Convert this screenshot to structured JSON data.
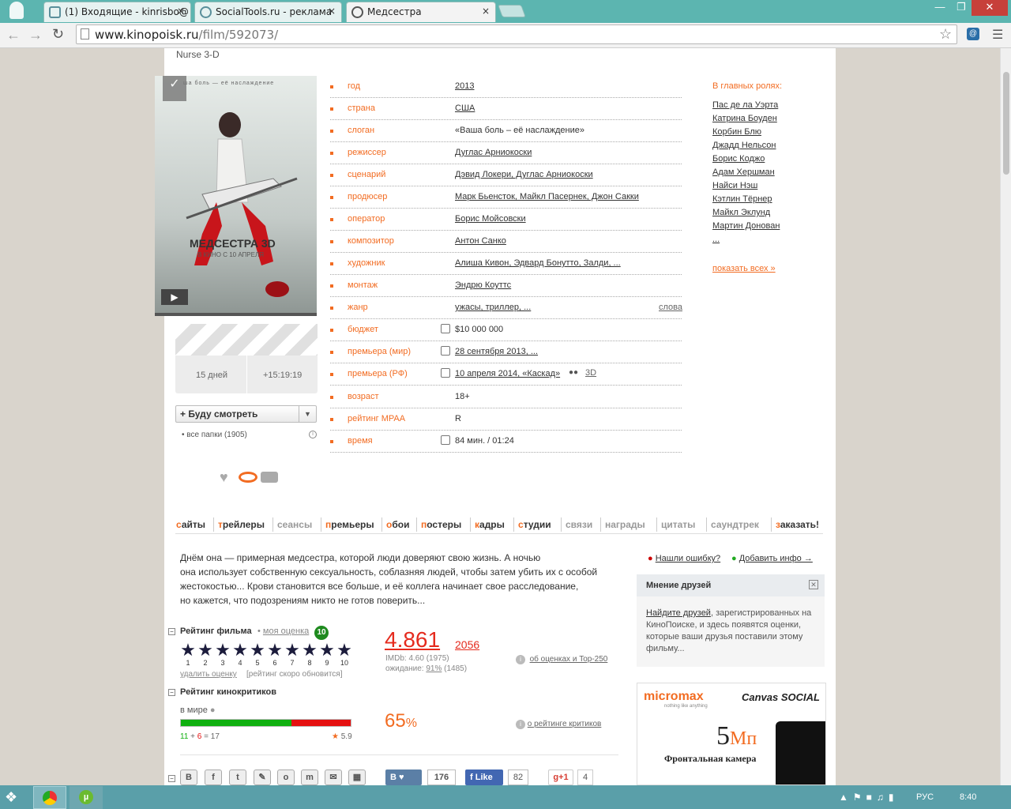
{
  "browser": {
    "tabs": [
      {
        "label": "(1) Входящие - kinrisbo@",
        "close": "×"
      },
      {
        "label": "SocialTools.ru - реклама",
        "close": "×"
      },
      {
        "label": "Медсестра",
        "close": "×"
      }
    ],
    "url_domain": "www.kinopoisk.ru",
    "url_path": "/film/592073/",
    "window_controls": [
      "—",
      "❐",
      "✕"
    ]
  },
  "film": {
    "original_title": "Nurse 3-D",
    "poster_tagline": "ша боль — её наслаждение",
    "poster_title": "МЕДСЕСТРА 3D",
    "poster_subtitle": "В КИНО С 10 АПРЕЛЯ",
    "countdown_days": "15 дней",
    "countdown_time": "+15:19:19",
    "watchlist_button": "Буду смотреть",
    "all_folders": "все папки (1905)",
    "info": [
      {
        "label": "год",
        "value": "2013"
      },
      {
        "label": "страна",
        "value": "США"
      },
      {
        "label": "слоган",
        "value": "«Ваша боль – её наслаждение»"
      },
      {
        "label": "режиссер",
        "value": "Дуглас Арниокоски"
      },
      {
        "label": "сценарий",
        "value": "Дэвид Локери, Дуглас Арниокоски"
      },
      {
        "label": "продюсер",
        "value": "Марк Бьенсток, Майкл Пасернек, Джон Сакки"
      },
      {
        "label": "оператор",
        "value": "Борис Мойсовски"
      },
      {
        "label": "композитор",
        "value": "Антон Санко"
      },
      {
        "label": "художник",
        "value": "Алиша Кивон, Эдвард Бонутто, Залди, ..."
      },
      {
        "label": "монтаж",
        "value": "Эндрю Коуттс"
      },
      {
        "label": "жанр",
        "value": "ужасы, триллер, ..."
      },
      {
        "label": "бюджет",
        "value": "$10 000 000"
      },
      {
        "label": "премьера (мир)",
        "value": "28 сентября 2013, ..."
      },
      {
        "label": "премьера (РФ)",
        "value": "10 апреля 2014, «Каскад»"
      },
      {
        "label": "возраст",
        "value": "18+"
      },
      {
        "label": "рейтинг MPAA",
        "value": "R"
      },
      {
        "label": "время",
        "value": "84 мин. / 01:24"
      }
    ],
    "genre_words_link": "слова",
    "premiere_3d": "3D",
    "cast_title": "В главных ролях:",
    "cast": [
      "Пас де ла Уэрта",
      "Катрина Боуден",
      "Корбин Блю",
      "Джадд Нельсон",
      "Борис Коджо",
      "Адам Хершман",
      "Найси Нэш",
      "Кэтлин Тёрнер",
      "Майкл Эклунд",
      "Мартин Донован",
      "..."
    ],
    "show_all": "показать всех »"
  },
  "menu_tabs": [
    {
      "first": "с",
      "rest": "айты",
      "active": true
    },
    {
      "first": "т",
      "rest": "рейлеры",
      "active": true
    },
    {
      "first": "",
      "rest": "сеансы",
      "active": false
    },
    {
      "first": "п",
      "rest": "ремьеры",
      "active": true
    },
    {
      "first": "о",
      "rest": "бои",
      "active": true
    },
    {
      "first": "п",
      "rest": "остеры",
      "active": true
    },
    {
      "first": "к",
      "rest": "адры",
      "active": true
    },
    {
      "first": "с",
      "rest": "тудии",
      "active": true
    },
    {
      "first": "",
      "rest": "связи",
      "active": false
    },
    {
      "first": "",
      "rest": "награды",
      "active": false
    },
    {
      "first": "",
      "rest": "цитаты",
      "active": false
    },
    {
      "first": "",
      "rest": "саундтрек",
      "active": false
    },
    {
      "first": "з",
      "rest": "аказать!",
      "active": true
    }
  ],
  "description": [
    "Днём она — примерная медсестра, которой люди доверяют свою жизнь. А ночью",
    "она использует собственную сексуальность, соблазняя людей, чтобы затем убить их с особой",
    "жестокостью... Крови становится все больше, и её коллега начинает свое расследование,",
    "но кажется, что подозрениям никто не готов поверить..."
  ],
  "side_links": {
    "error": "Нашли ошибку?",
    "add_info": "Добавить инфо →"
  },
  "friends_box": {
    "title": "Мнение друзей",
    "link": "Найдите друзей",
    "text": ", зарегистрированных на КиноПоиске, и здесь появятся оценки, которые ваши друзья поставили этому фильму..."
  },
  "rating": {
    "title": "Рейтинг фильма",
    "my_rating_label": "моя оценка",
    "my_rating": "10",
    "value": "4.861",
    "votes": "2056",
    "imdb": "IMDb: 4.60 (1975)",
    "expectation_label": "ожидание:",
    "expectation": "91%",
    "expectation_votes": "(1485)",
    "delete": "удалить оценку",
    "update_note": "[рейтинг скоро обновится]",
    "about_link": "об оценках и Top-250",
    "star_numbers": [
      "1",
      "2",
      "3",
      "4",
      "5",
      "6",
      "7",
      "8",
      "9",
      "10"
    ]
  },
  "critics": {
    "title": "Рейтинг кинокритиков",
    "world_label": "в мире",
    "positive_fraction": 0.65,
    "value": "65",
    "percent_sign": "%",
    "positive": "11",
    "negative": "6",
    "total": "17",
    "score": "5.9",
    "about_link": "о рейтинге критиков"
  },
  "social": {
    "vk_label": "В",
    "vk_count": "176",
    "fb_label": "Like",
    "fb_count": "82",
    "gplus_label": "g+1",
    "gplus_count": "4"
  },
  "ad": {
    "brand": "micromax",
    "brand_tagline": "nothing like anything",
    "model": "Canvas SOCIAL",
    "mp_number": "5",
    "mp_unit": "Мп",
    "caption": "Фронтальная камера"
  },
  "taskbar": {
    "lang": "РУС",
    "time": "8:40"
  },
  "colors": {
    "accent": "#f26c22",
    "rating_red": "#e52b1e",
    "critic_green": "#10b010",
    "critic_red": "#e51010"
  }
}
